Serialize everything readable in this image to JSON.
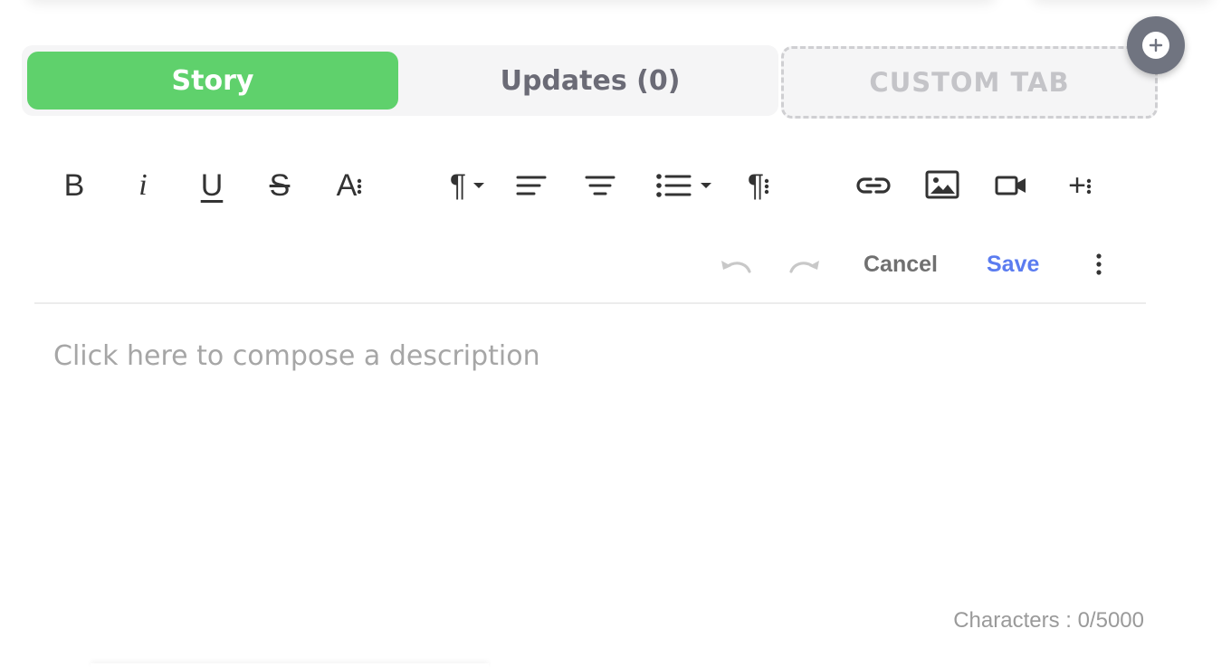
{
  "tabs": {
    "story_label": "Story",
    "updates_label": "Updates (0)",
    "custom_label": "CUSTOM TAB"
  },
  "toolbar": {
    "bold": "B",
    "italic": "i",
    "underline": "U",
    "strike": "S",
    "font_size": "A",
    "paragraph": "¶",
    "paragraph_more": "¶",
    "insert_more": "+"
  },
  "actions": {
    "cancel_label": "Cancel",
    "save_label": "Save"
  },
  "editor": {
    "placeholder": "Click here to compose a description"
  },
  "footer": {
    "char_count": "Characters : 0/5000"
  },
  "colors": {
    "accent_green": "#5fd16c",
    "save_blue": "#5b7cf0",
    "fab_gray": "#707480"
  },
  "icons": [
    "plus-circle-icon",
    "undo-icon",
    "redo-icon",
    "more-vertical-icon",
    "align-left-icon",
    "align-center-icon",
    "unordered-list-icon",
    "link-icon",
    "image-icon",
    "video-icon",
    "dropdown-arrow-icon"
  ]
}
